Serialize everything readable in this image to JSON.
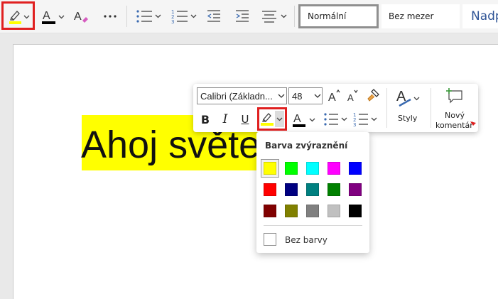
{
  "ribbon": {
    "styles": [
      {
        "label": "Normální"
      },
      {
        "label": "Bez mezer"
      },
      {
        "label": "Nadp"
      }
    ]
  },
  "document": {
    "text": "Ahoj světe"
  },
  "floatie": {
    "font_name": "Calibri (Základn...",
    "font_size": "48",
    "bold_label": "B",
    "italic_label": "I",
    "underline_label": "U",
    "styles_label": "Styly",
    "comment_label_line1": "Nový",
    "comment_label_line2": "komentář"
  },
  "highlight_panel": {
    "title": "Barva zvýraznění",
    "selected_color": "#ffff00",
    "colors": [
      "#ffff00",
      "#00ff00",
      "#00ffff",
      "#ff00ff",
      "#0000ff",
      "#ff0000",
      "#000080",
      "#008080",
      "#008000",
      "#800080",
      "#800000",
      "#808000",
      "#808080",
      "#c0c0c0",
      "#000000"
    ],
    "no_color_label": "Bez barvy"
  },
  "colors": {
    "highlight": "#ffff00",
    "font_color": "#000000",
    "annotation_red": "#e02020"
  }
}
